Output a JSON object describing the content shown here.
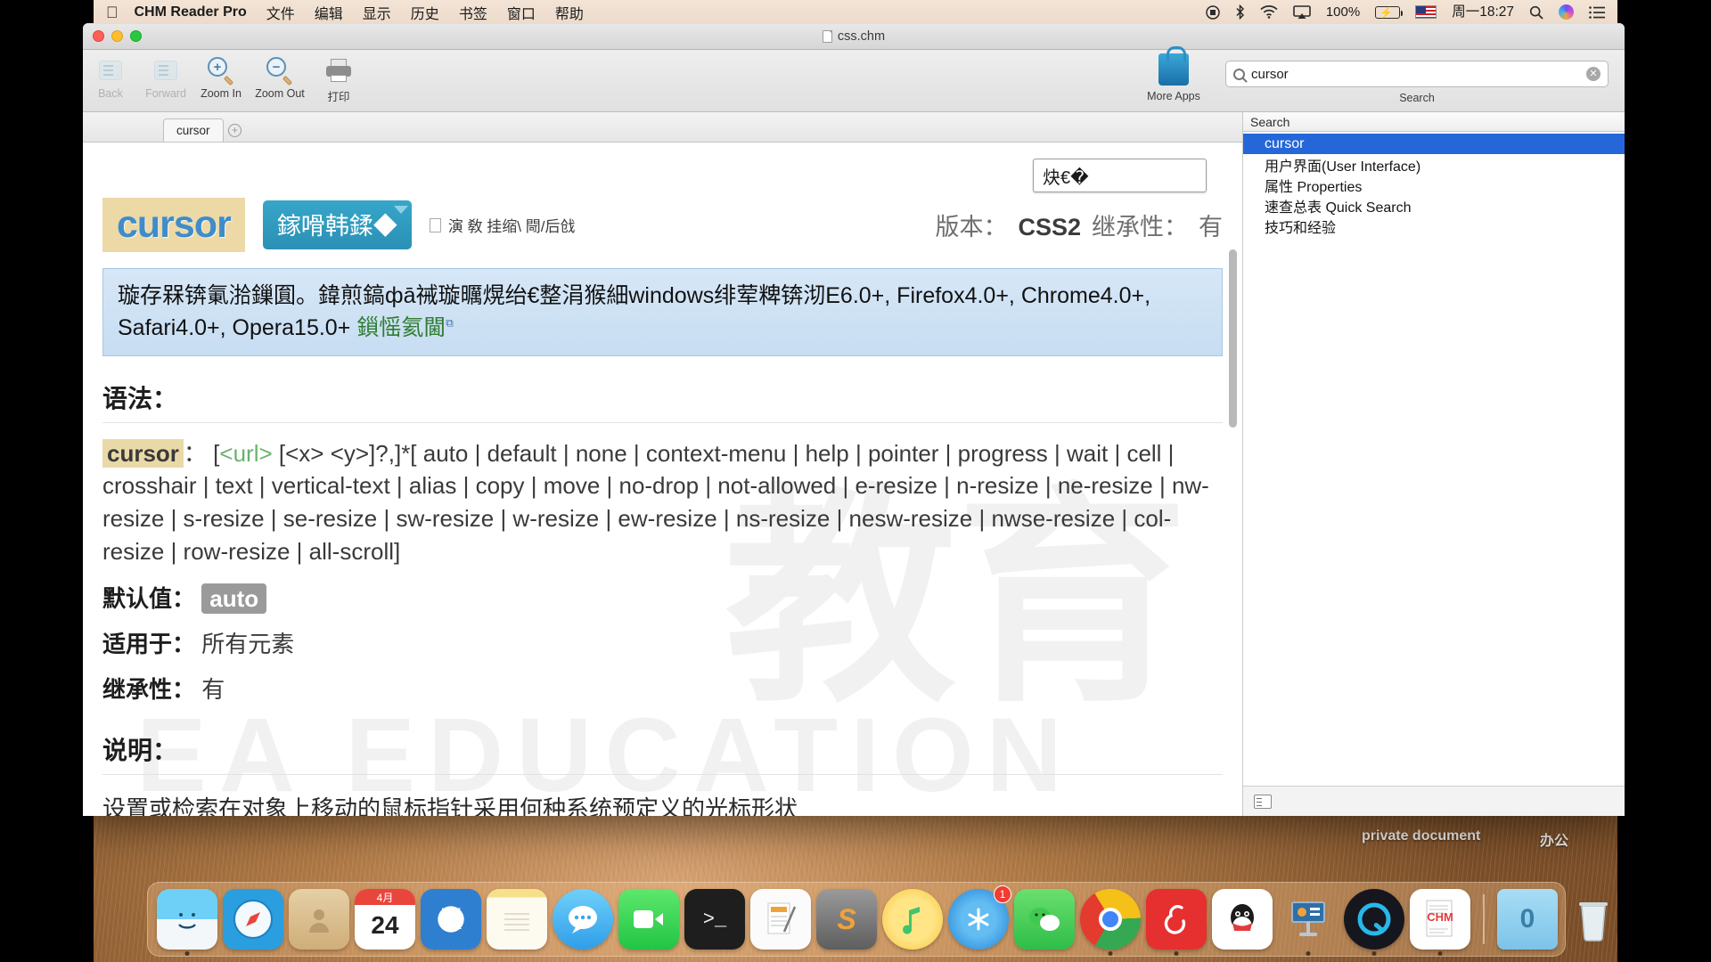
{
  "menubar": {
    "apple": "",
    "app_name": "CHM Reader Pro",
    "items": [
      "文件",
      "编辑",
      "显示",
      "历史",
      "书签",
      "窗口",
      "帮助"
    ],
    "status": {
      "record_icon": "record-icon",
      "bluetooth_icon": "bluetooth-icon",
      "wifi_icon": "wifi-icon",
      "airplay_icon": "airplay-icon",
      "battery_percent": "100%",
      "battery_icon": "battery-charging-icon",
      "input_flag": "us-flag-icon",
      "clock": "周一18:27",
      "spotlight_icon": "search-icon",
      "siri_icon": "siri-icon",
      "notification_icon": "list-icon"
    }
  },
  "window": {
    "title": "css.chm",
    "toolbar": {
      "back": "Back",
      "forward": "Forward",
      "zoom_in": "Zoom In",
      "zoom_out": "Zoom Out",
      "print": "打印",
      "more_apps": "More Apps",
      "search_caption": "Search",
      "search_value": "cursor",
      "search_placeholder": "Search"
    },
    "tabs": [
      {
        "label": "cursor"
      }
    ],
    "tab_add": "+"
  },
  "content": {
    "find_field_value": "炔€�",
    "logo_text": "cursor",
    "blue_button_text": "鎵嗗韩鍒◆",
    "breadcrumb": "演 敎 挂缩\\  閜/后戗",
    "version_label": "版本：",
    "version_value": "CSS2",
    "inherit_label": "继承性：",
    "inherit_value": "有",
    "note": "璇存槑锛氭湁鏁圎。鍏煎鎬фā祴璇曞熀绐€整涓猴細windows绯荤粺锛沏E6.0+, Firefox4.0+, Chrome4.0+, Safari4.0+, Opera15.0+",
    "note_link": "鎻愮氦閫",
    "syntax_heading": "语法：",
    "syntax_property": "cursor",
    "syntax_colon": "：",
    "syntax_url": "<url>",
    "syntax_body": " [<x> <y>]?,]*[ auto | default | none | context-menu | help | pointer | progress | wait | cell | crosshair | text | vertical-text | alias | copy | move | no-drop | not-allowed | e-resize | n-resize | ne-resize | nw-resize | s-resize | se-resize | sw-resize | w-resize | ew-resize | ns-resize | nesw-resize | nwse-resize | col-resize | row-resize | all-scroll]",
    "syntax_open": " [",
    "default_label": "默认值：",
    "default_value": "auto",
    "applies_label": "适用于：",
    "applies_value": "所有元素",
    "inherited_label": "继承性：",
    "inherited_value": "有",
    "desc_heading": "说明：",
    "desc_text": "设置或检索在对象上移动的鼠标指针采用何种系统预定义的光标形状",
    "watermark_1": "教育",
    "watermark_2": "EA EDUCATION"
  },
  "sidebar": {
    "header": "Search",
    "items": [
      {
        "label": "cursor",
        "selected": true
      },
      {
        "label": "用户界面(User Interface)",
        "selected": false
      },
      {
        "label": "属性 Properties",
        "selected": false
      },
      {
        "label": "速查总表 Quick Search",
        "selected": false
      },
      {
        "label": "技巧和经验",
        "selected": false
      }
    ],
    "footer_icon": "list-view-icon"
  },
  "desktop": {
    "label_private": "private document",
    "label_office": "办公"
  },
  "dock": {
    "items": [
      {
        "name": "finder",
        "glyph": "☺",
        "color": "#2196f3",
        "running": true
      },
      {
        "name": "safari",
        "glyph": "🧭",
        "color": "#e8f4fd",
        "running": false
      },
      {
        "name": "contacts",
        "glyph": "",
        "color": "#d8c09a",
        "running": false
      },
      {
        "name": "calendar",
        "glyph": "24",
        "color": "#ffffff",
        "running": false
      },
      {
        "name": "kindle",
        "glyph": "K",
        "color": "#2e7fd1",
        "running": false
      },
      {
        "name": "notes",
        "glyph": "",
        "color": "#fdf6d8",
        "running": false
      },
      {
        "name": "messages",
        "glyph": "…",
        "color": "#4fc3f7",
        "running": false
      },
      {
        "name": "facetime",
        "glyph": "",
        "color": "#3ddc65",
        "running": false
      },
      {
        "name": "terminal",
        "glyph": ">_",
        "color": "#2b2b2b",
        "running": false
      },
      {
        "name": "pages",
        "glyph": "",
        "color": "#f2f2f2",
        "running": false
      },
      {
        "name": "sublime",
        "glyph": "S",
        "color": "#6d6d6d",
        "running": false
      },
      {
        "name": "itunes",
        "glyph": "♪",
        "color": "#f5d04e",
        "running": false
      },
      {
        "name": "app-store",
        "glyph": "A",
        "color": "#2a8fe0",
        "running": false,
        "badge": "1"
      },
      {
        "name": "wechat",
        "glyph": "",
        "color": "#4ecb5a",
        "running": false
      },
      {
        "name": "chrome",
        "glyph": "",
        "color": "#ffffff",
        "running": true
      },
      {
        "name": "netease-music",
        "glyph": "♬",
        "color": "#e62f2f",
        "running": true
      },
      {
        "name": "qq",
        "glyph": "",
        "color": "#ffffff",
        "running": false
      },
      {
        "name": "keynote",
        "glyph": "",
        "color": "#cfd6dd",
        "running": true
      },
      {
        "name": "quicktime",
        "glyph": "Q",
        "color": "#1b1b2e",
        "running": true
      },
      {
        "name": "chm-reader",
        "glyph": "CHM",
        "color": "#ffffff",
        "running": true
      },
      {
        "name": "downloads-folder",
        "glyph": "0",
        "color": "#8fd3f4",
        "running": false
      },
      {
        "name": "trash",
        "glyph": "",
        "color": "#e0e0e0",
        "running": false
      }
    ]
  }
}
